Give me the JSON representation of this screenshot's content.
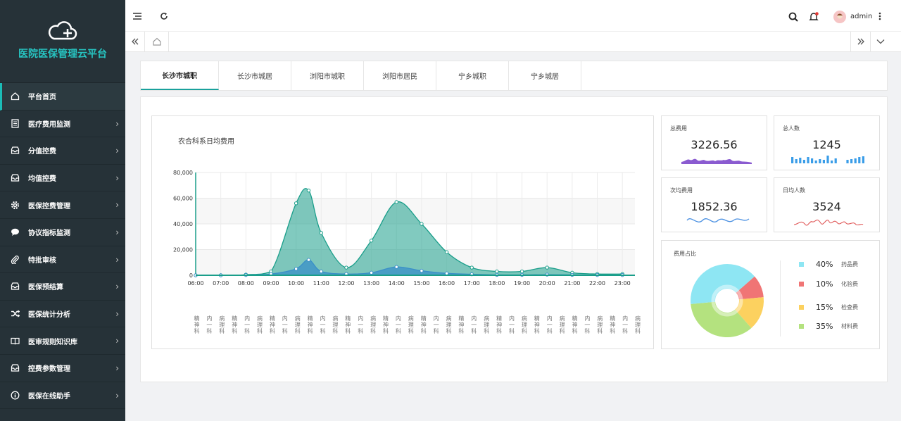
{
  "app": {
    "title": "医院医保管理云平台"
  },
  "sidebar": {
    "items": [
      {
        "label": "平台首页",
        "icon": "home-icon"
      },
      {
        "label": "医疗费用监测",
        "icon": "document-icon"
      },
      {
        "label": "分值控费",
        "icon": "inbox-icon"
      },
      {
        "label": "均值控费",
        "icon": "inbox-icon"
      },
      {
        "label": "医保控费管理",
        "icon": "gear-icon"
      },
      {
        "label": "协议指标监测",
        "icon": "chat-icon"
      },
      {
        "label": "特批审核",
        "icon": "paperclip-icon"
      },
      {
        "label": "医保预结算",
        "icon": "inbox-icon"
      },
      {
        "label": "医保统计分析",
        "icon": "shuffle-icon"
      },
      {
        "label": "医审规则知识库",
        "icon": "book-icon"
      },
      {
        "label": "控费参数管理",
        "icon": "inbox-icon"
      },
      {
        "label": "医保在线助手",
        "icon": "info-icon"
      }
    ]
  },
  "header": {
    "username": "admin"
  },
  "tabs": [
    "长沙市城职",
    "长沙市城居",
    "浏阳市城职",
    "浏阳市居民",
    "宁乡城职",
    "宁乡城居"
  ],
  "stats": {
    "total_cost": {
      "label": "总费用",
      "value": "3226.56"
    },
    "total_people": {
      "label": "总人数",
      "value": "1245"
    },
    "per_visit_cost": {
      "label": "次均费用",
      "value": "1852.36"
    },
    "daily_people": {
      "label": "日均人数",
      "value": "3524"
    }
  },
  "pie": {
    "title": "费用占比",
    "items": [
      {
        "pct": "40%",
        "name": "药品费",
        "color": "#8ee6f3"
      },
      {
        "pct": "10%",
        "name": "化验费",
        "color": "#f07575"
      },
      {
        "pct": "15%",
        "name": "检查费",
        "color": "#fcd15f"
      },
      {
        "pct": "35%",
        "name": "材料费",
        "color": "#b4e27f"
      }
    ]
  },
  "chart_data": {
    "type": "area",
    "title": "农合科系日均费用",
    "x": [
      "06:00",
      "07:00",
      "08:00",
      "09:00",
      "10:00",
      "10:30",
      "11:00",
      "12:00",
      "13:00",
      "14:00",
      "15:00",
      "16:00",
      "17:00",
      "18:00",
      "19:00",
      "20:00",
      "21:00",
      "22:00",
      "23:00"
    ],
    "xticks": [
      "06:00",
      "07:00",
      "08:00",
      "09:00",
      "10:00",
      "11:00",
      "12:00",
      "13:00",
      "14:00",
      "15:00",
      "16:00",
      "17:00",
      "18:00",
      "19:00",
      "20:00",
      "21:00",
      "22:00",
      "23:00"
    ],
    "ylim": [
      0,
      80000
    ],
    "yticks": [
      "0",
      "20,000",
      "40,000",
      "60,000",
      "80,000"
    ],
    "series": [
      {
        "color": "#1a9e8a",
        "values": [
          0,
          0,
          500,
          3000,
          56000,
          66000,
          33000,
          6000,
          27000,
          57000,
          40000,
          18000,
          6000,
          3000,
          3000,
          6000,
          2000,
          1000,
          1000
        ]
      },
      {
        "color": "#3a8fc8",
        "values": [
          0,
          0,
          200,
          1000,
          5000,
          12000,
          3000,
          1000,
          2000,
          6500,
          3500,
          1500,
          800,
          300,
          300,
          500,
          300,
          200,
          200
        ]
      }
    ],
    "categories": [
      "精神科",
      "内一科",
      "病理科",
      "精神科",
      "内一科",
      "病理科",
      "精神科",
      "内一科",
      "病理科",
      "精神科",
      "内一科",
      "病理科",
      "精神科",
      "内一科",
      "病理科",
      "精神科",
      "内一科",
      "病理科",
      "精神科",
      "内一科",
      "病理科",
      "精神科",
      "内一科",
      "病理科",
      "精神科",
      "内一科",
      "病理科",
      "精神科",
      "内一科",
      "病理科",
      "精神科",
      "内一科",
      "病理科",
      "精神科",
      "内一科",
      "病理科"
    ]
  }
}
